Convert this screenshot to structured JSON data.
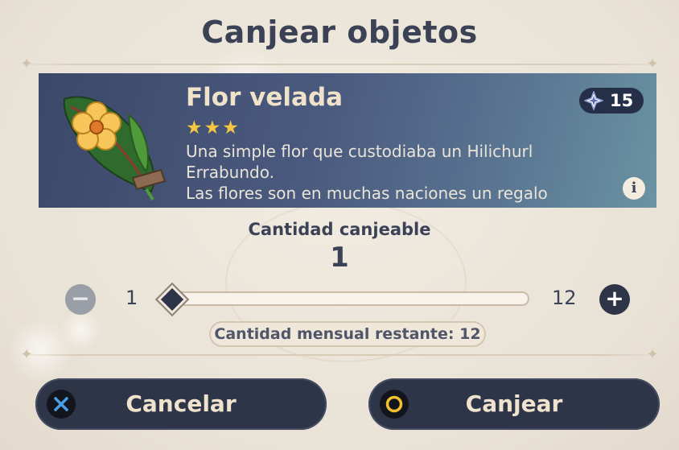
{
  "dialog": {
    "title": "Canjear objetos"
  },
  "item": {
    "name": "Flor velada",
    "stars": "★★★",
    "rarity": 3,
    "description": "Una simple flor que custodiaba un Hilichurl Errabundo.\nLas flores son en muchas naciones un regalo",
    "cost": "15",
    "cost_icon": "starglitter-icon",
    "info_icon": "info-icon"
  },
  "quantity": {
    "label": "Cantidad canjeable",
    "value": "1",
    "min": "1",
    "max": "12",
    "slider_fraction": 0.0,
    "monthly_remaining": "Cantidad mensual restante: 12"
  },
  "buttons": {
    "cancel_label": "Cancelar",
    "confirm_label": "Canjear",
    "cancel_icon": "cross-icon",
    "confirm_icon": "circle-icon"
  },
  "colors": {
    "button_bg": "#2f3549",
    "title_text": "#3b4256",
    "star": "#f6c642",
    "item_name": "#f0e3c9",
    "cancel_icon": "#4a9ee8",
    "confirm_icon": "#f2c12e"
  }
}
